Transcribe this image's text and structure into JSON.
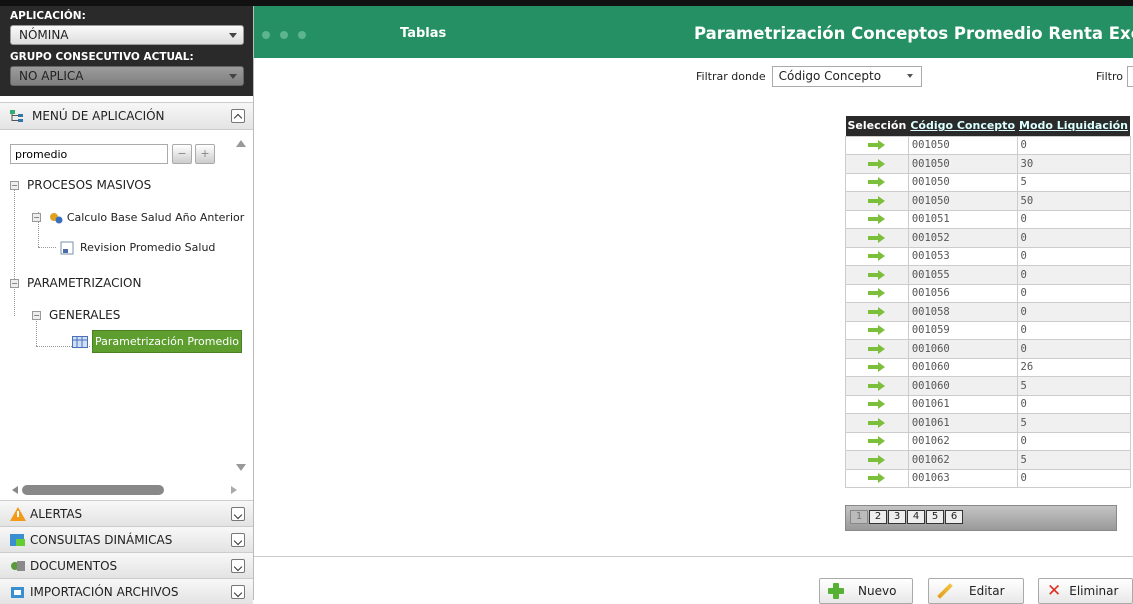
{
  "sidebar": {
    "app_label": "APLICACIÓN:",
    "app_value": "NÓMINA",
    "grupo_label": "GRUPO CONSECUTIVO ACTUAL:",
    "grupo_value": "NO APLICA",
    "menu_title": "MENÚ DE APLICACIÓN",
    "search_value": "promedio",
    "tree": {
      "procesos": "PROCESOS MASIVOS",
      "calculo": "Calculo Base Salud Año Anterior",
      "revision": "Revision Promedio Salud",
      "param": "PARAMETRIZACION",
      "generales": "GENERALES",
      "param_promedio": "Parametrización Promedio"
    },
    "accordion": [
      "ALERTAS",
      "CONSULTAS DINÁMICAS",
      "DOCUMENTOS",
      "IMPORTACIÓN ARCHIVOS"
    ]
  },
  "header": {
    "tablas": "Tablas",
    "title": "Parametrización Conceptos Promedio Renta Exenta"
  },
  "filter": {
    "label": "Filtrar donde",
    "selected": "Código Concepto",
    "filtro_label": "Filtro"
  },
  "grid": {
    "headers": [
      "Selección",
      "Código Concepto",
      "Modo Liquidación"
    ],
    "rows": [
      [
        "001050",
        "0"
      ],
      [
        "001050",
        "30"
      ],
      [
        "001050",
        "5"
      ],
      [
        "001050",
        "50"
      ],
      [
        "001051",
        "0"
      ],
      [
        "001052",
        "0"
      ],
      [
        "001053",
        "0"
      ],
      [
        "001055",
        "0"
      ],
      [
        "001056",
        "0"
      ],
      [
        "001058",
        "0"
      ],
      [
        "001059",
        "0"
      ],
      [
        "001060",
        "0"
      ],
      [
        "001060",
        "26"
      ],
      [
        "001060",
        "5"
      ],
      [
        "001061",
        "0"
      ],
      [
        "001061",
        "5"
      ],
      [
        "001062",
        "0"
      ],
      [
        "001062",
        "5"
      ],
      [
        "001063",
        "0"
      ]
    ],
    "pages": [
      "1",
      "2",
      "3",
      "4",
      "5",
      "6"
    ]
  },
  "buttons": {
    "nuevo": "Nuevo",
    "editar": "Editar",
    "eliminar": "Eliminar"
  }
}
